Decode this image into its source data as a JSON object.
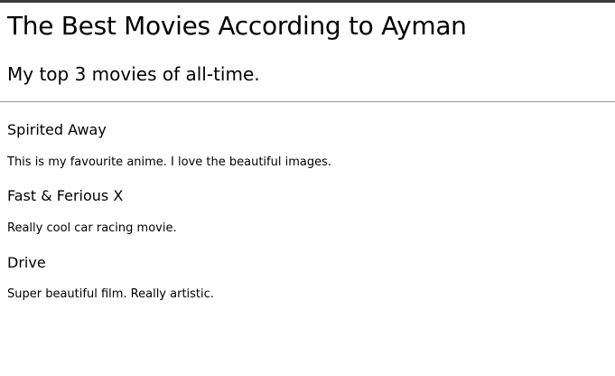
{
  "page": {
    "title": "The Best Movies According to Ayman",
    "subtitle": "My top 3 movies of all-time."
  },
  "movies": [
    {
      "title": "Spirited Away",
      "description": "This is my favourite anime. I love the beautiful images."
    },
    {
      "title": "Fast & Ferious X",
      "description": "Really cool car racing movie."
    },
    {
      "title": "Drive",
      "description": "Super beautiful film. Really artistic."
    }
  ],
  "colors": {
    "top_bar": "#3c3c3c",
    "divider": "#9a9a9a",
    "text": "#000000",
    "background": "#ffffff"
  }
}
